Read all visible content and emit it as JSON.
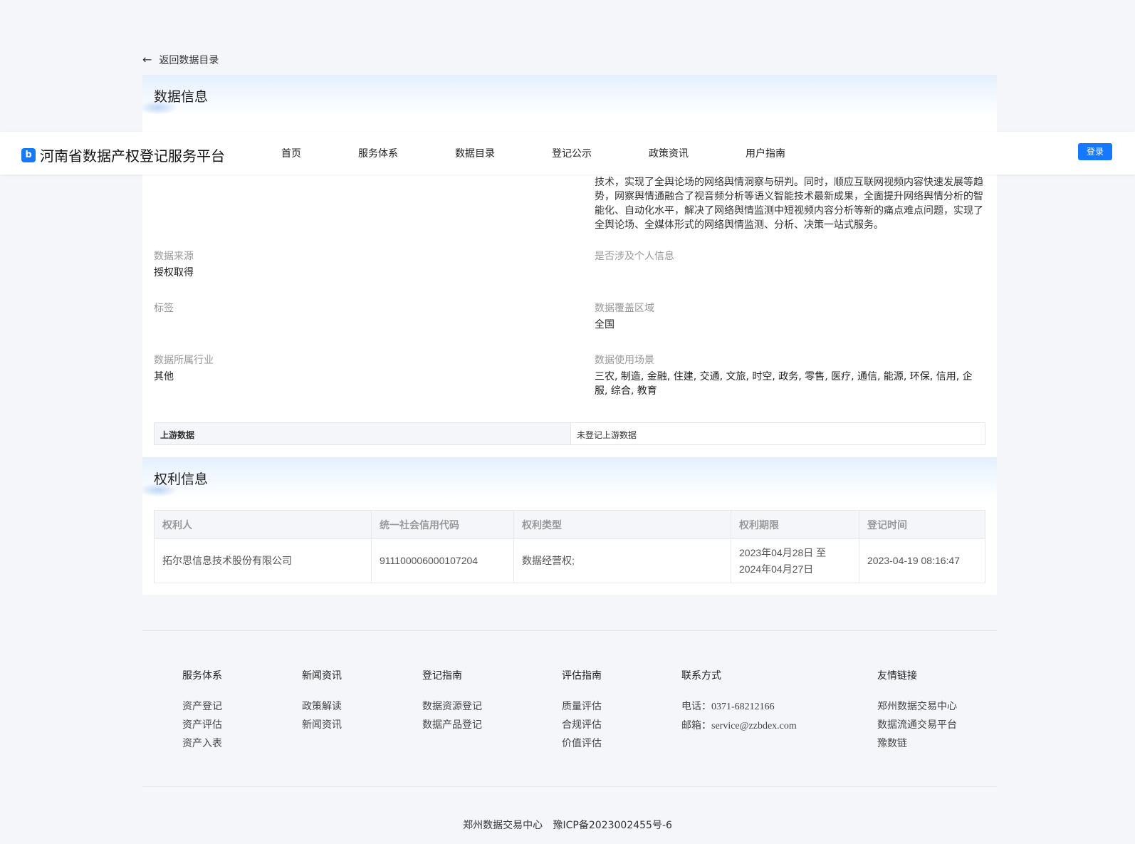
{
  "back": {
    "label": "返回数据目录"
  },
  "sections": {
    "data_info_title": "数据信息",
    "rights_info_title": "权利信息"
  },
  "data_info": {
    "description_lines": [
      "技术，实现了全舆论场的网络舆情洞察与研判。同时，顺应互联网视频内容快速发展等趋",
      "势，网察舆情通融合了视音频分析等语义智能技术最新成果，全面提升网络舆情分析的智",
      "能化、自动化水平，解决了网络舆情监测中短视频内容分析等新的痛点难点问题，实现了",
      "全舆论场、全媒体形式的网络舆情监测、分析、决策一站式服务。"
    ],
    "source_label": "数据来源",
    "source_value": "授权取得",
    "personal_label": "是否涉及个人信息",
    "tags_label": "标签",
    "coverage_label": "数据覆盖区域",
    "coverage_value": "全国",
    "industry_label": "数据所属行业",
    "industry_value": "其他",
    "scenario_label": "数据使用场景",
    "scenario_value": "三农, 制造, 金融, 住建, 交通, 文旅, 时空, 政务, 零售, 医疗, 通信, 能源, 环保, 信用, 企服, 综合, 教育"
  },
  "upstream": {
    "label": "上游数据",
    "value": "未登记上游数据"
  },
  "rights_table": {
    "headers": [
      "权利人",
      "统一社会信用代码",
      "权利类型",
      "权利期限",
      "登记时间"
    ],
    "row": {
      "holder": "拓尔思信息技术股份有限公司",
      "credit_code": "911100006000107204",
      "right_type": "数据经营权;",
      "period_line1": "2023年04月28日 至",
      "period_line2": "2024年04月27日",
      "registered": "2023-04-19 08:16:47"
    }
  },
  "navbar": {
    "logo_text": "河南省数据产权登记服务平台",
    "items": [
      "首页",
      "服务体系",
      "数据目录",
      "登记公示",
      "政策资讯",
      "用户指南"
    ],
    "login": "登录"
  },
  "footer": {
    "columns": [
      {
        "title": "服务体系",
        "links": [
          "资产登记",
          "资产评估",
          "资产入表"
        ]
      },
      {
        "title": "新闻资讯",
        "links": [
          "政策解读",
          "新闻资讯"
        ]
      },
      {
        "title": "登记指南",
        "links": [
          "数据资源登记",
          "数据产品登记"
        ]
      },
      {
        "title": "评估指南",
        "links": [
          "质量评估",
          "合规评估",
          "价值评估"
        ]
      },
      {
        "title": "友情链接",
        "links": [
          "郑州数据交易中心",
          "数据流通交易平台",
          "豫数链"
        ]
      }
    ],
    "contact": {
      "title": "联系方式",
      "phone_label": "电话：",
      "phone": "0371-68212166",
      "email_label": "邮箱：",
      "email": "service@zzbdex.com"
    },
    "copyright_org": "郑州数据交易中心",
    "icp": "豫ICP备2023002455号-6"
  },
  "colors": {
    "accent": "#1677ff",
    "page_bg": "#f5f6fa"
  },
  "icons": {
    "back": "arrow-left-icon",
    "logo": "logo-icon"
  }
}
